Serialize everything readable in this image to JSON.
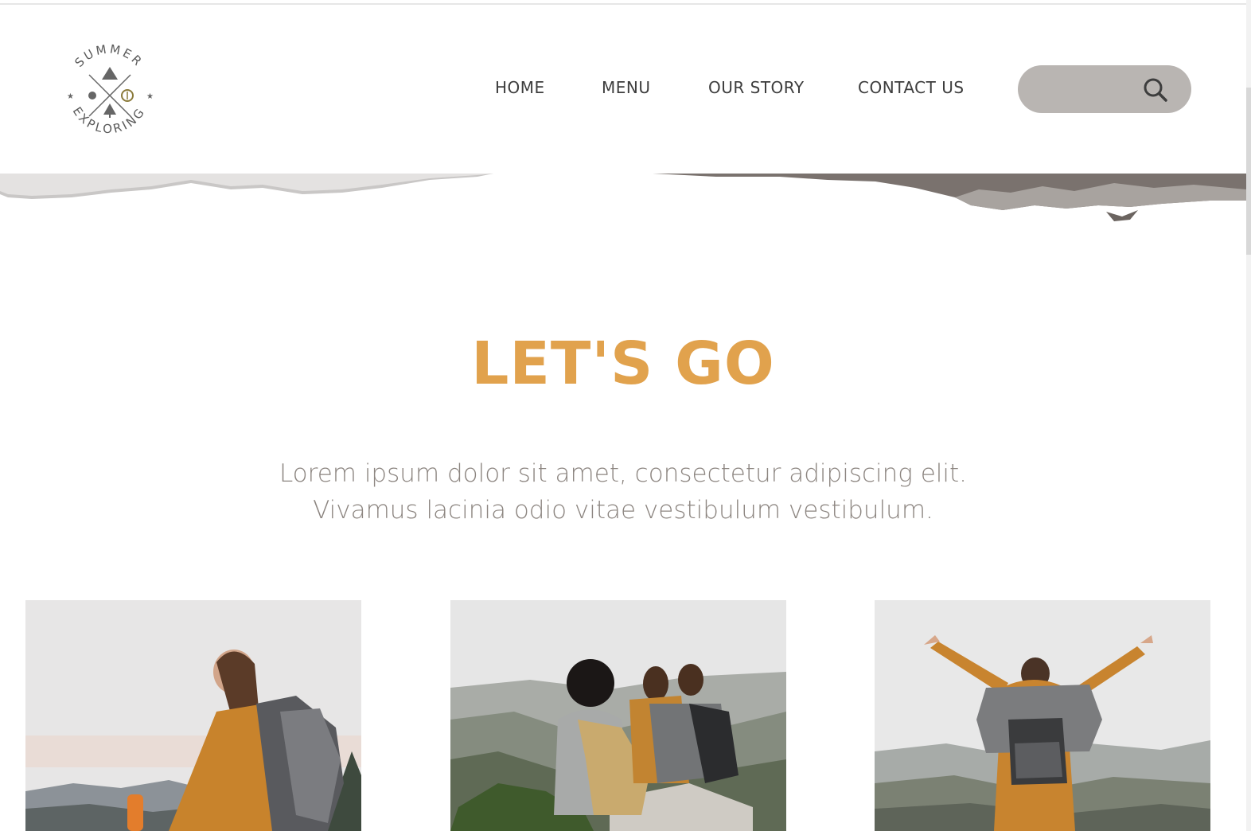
{
  "brand": {
    "logo_top_text": "SUMMER",
    "logo_bottom_text": "EXPLORING"
  },
  "nav": {
    "items": [
      {
        "label": "HOME"
      },
      {
        "label": "MENU"
      },
      {
        "label": "OUR STORY"
      },
      {
        "label": "CONTACT US"
      }
    ]
  },
  "search": {
    "value": "",
    "placeholder": "",
    "icon": "search-icon"
  },
  "hero": {
    "title": "LET'S GO",
    "line1": "Lorem ipsum dolor sit amet, consectetur adipiscing elit.",
    "line2": "Vivamus lacinia odio vitae vestibulum vestibulum."
  },
  "gallery": {
    "photos": [
      {
        "subject": "hiker woman laughing with backpack"
      },
      {
        "subject": "three hikers sitting on rock overlooking valley"
      },
      {
        "subject": "hiker with arms raised on mountain"
      }
    ]
  },
  "colors": {
    "accent": "#e1a24d",
    "nav_text": "#3d3d3d",
    "body_text": "#8c8580",
    "search_bg": "#b9b5b2"
  }
}
